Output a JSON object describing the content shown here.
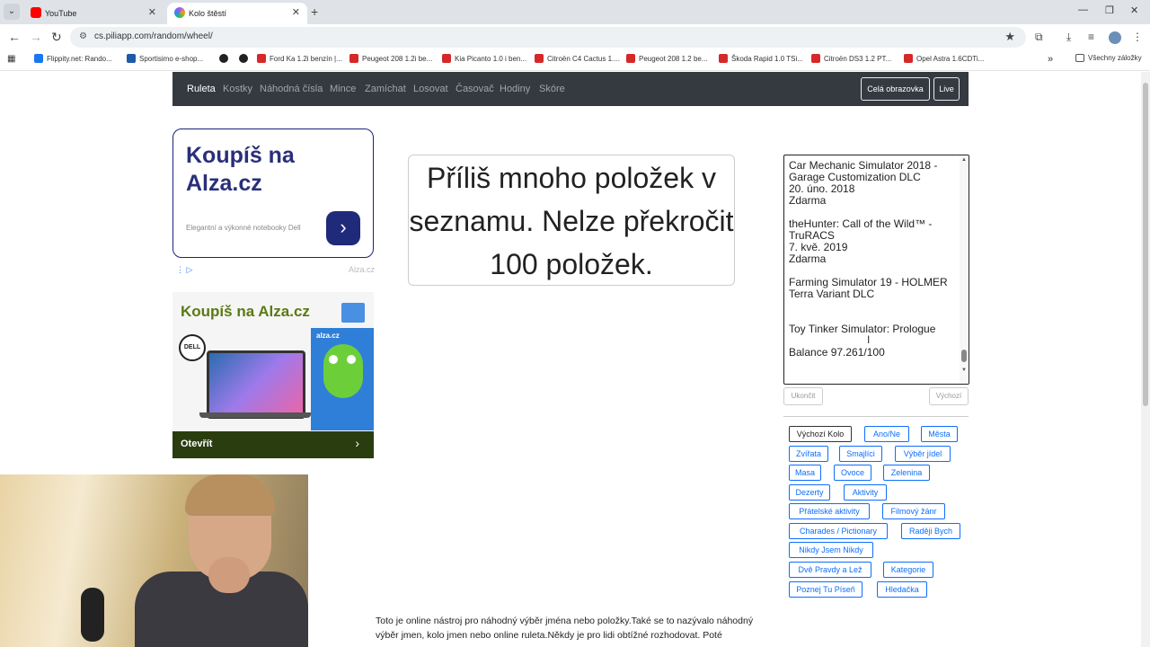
{
  "browser": {
    "tabs": [
      {
        "title": "YouTube",
        "favicon_color": "#ff0000"
      },
      {
        "title": "Kolo štěstí",
        "favicon_color": "#a855f7"
      }
    ],
    "url": "cs.piliapp.com/random/wheel/",
    "bookmarks": [
      {
        "label": "Flippity.net: Rando...",
        "color": "#1877f2"
      },
      {
        "label": "Sportisimo e-shop...",
        "color": "#1e5aa8"
      },
      {
        "label": "",
        "color": "#222222"
      },
      {
        "label": "",
        "color": "#222222"
      },
      {
        "label": "Ford Ka 1.2i benzín |...",
        "color": "#d62828"
      },
      {
        "label": "Peugeot 208 1.2i be...",
        "color": "#d62828"
      },
      {
        "label": "Kia Picanto 1.0 i ben...",
        "color": "#d62828"
      },
      {
        "label": "Citroën C4 Cactus 1....",
        "color": "#d62828"
      },
      {
        "label": "Peugeot 208 1.2 be...",
        "color": "#d62828"
      },
      {
        "label": "Škoda Rapid 1.0 TSi...",
        "color": "#d62828"
      },
      {
        "label": "Citroën DS3 1.2 PT...",
        "color": "#d62828"
      },
      {
        "label": "Opel Astra 1.6CDTi...",
        "color": "#d62828"
      }
    ],
    "all_bookmarks": "Všechny záložky"
  },
  "nav": {
    "links": [
      "Ruleta",
      "Kostky",
      "Náhodná čísla",
      "Mince",
      "Zamíchat",
      "Losovat",
      "Časovač",
      "Hodiny",
      "Skóre"
    ],
    "fullscreen": "Celá obrazovka",
    "live": "Live"
  },
  "ads": {
    "ad1_headline": "Koupíš na Alza.cz",
    "ad1_sub": "Elegantní a výkonné notebooky Dell",
    "ad1_brand": "Alza.cz",
    "ad2_headline": "Koupíš na Alza.cz",
    "ad2_dell": "DELL",
    "ad2_mascot_brand": "alza.cz",
    "ad2_open": "Otevřít"
  },
  "message": "Příliš mnoho položek v seznamu. Nelze překročit 100 položek.",
  "textarea": {
    "content": "Car Mechanic Simulator 2018 -\nGarage Customization DLC\n20. úno. 2018\nZdarma\n\ntheHunter: Call of the Wild™ -\nTruRACS\n7. kvě. 2019\nZdarma\n\nFarming Simulator 19 - HOLMER\nTerra Variant DLC\n\n\nToy Tinker Simulator: Prologue\n\nBalance 97.261/100"
  },
  "buttons": {
    "end": "Ukončit",
    "default": "Výchozí"
  },
  "presets": [
    "Výchozí Kolo",
    "Ano/Ne",
    "Města",
    "Zvířata",
    "Smajlíci",
    "Výběr jídel",
    "Masa",
    "Ovoce",
    "Zelenina",
    "Dezerty",
    "Aktivity",
    "Přátelské aktivity",
    "Filmový žánr",
    "Charades / Pictionary",
    "Raději Bych",
    "Nikdy Jsem Nikdy",
    "Dvě Pravdy a Lež",
    "Kategorie",
    "Poznej Tu Píseň",
    "Hledačka"
  ],
  "description": "Toto je online nástroj pro náhodný výběr jména nebo položky.Také se to nazývalo náhodný výběr jmen, kolo jmen nebo online ruleta.Někdy je pro lidi obtížné rozhodovat. Poté"
}
